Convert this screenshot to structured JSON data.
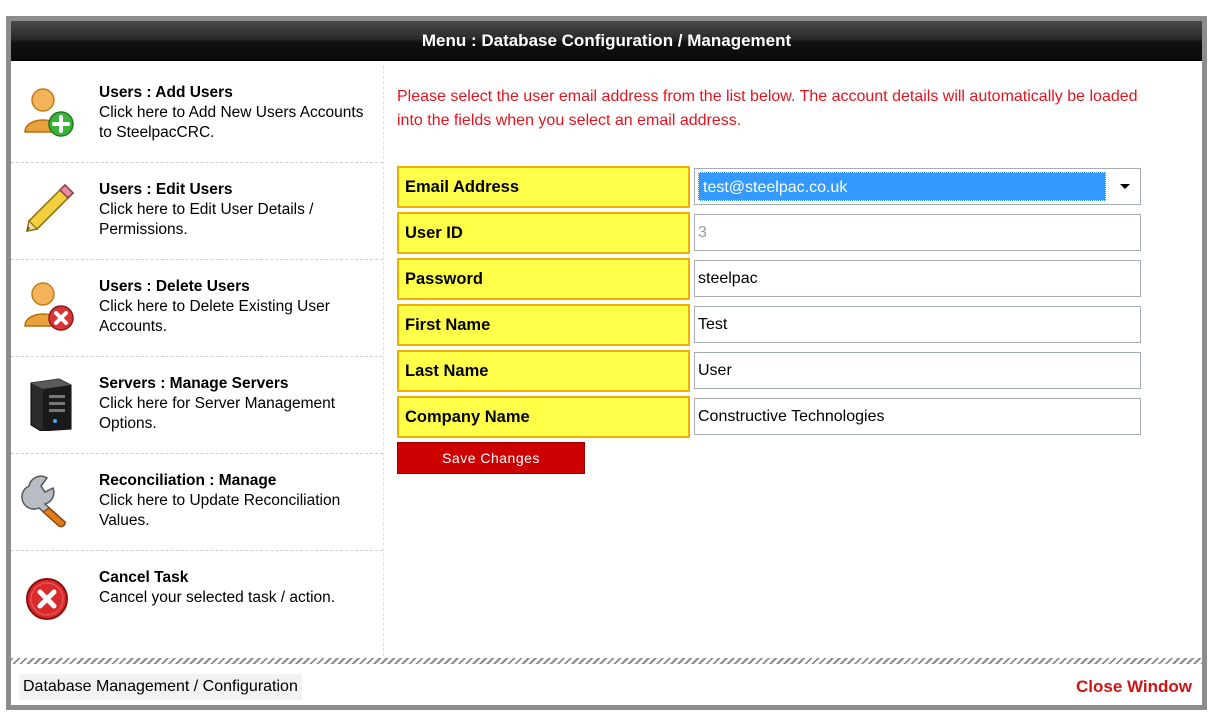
{
  "window": {
    "title": "Menu : Database Configuration / Management",
    "footer_label": "Database Management / Configuration",
    "close_label": "Close Window"
  },
  "sidebar": {
    "items": [
      {
        "icon": "add-user-icon",
        "title": "Users : Add Users",
        "desc": "Click here to Add New Users Accounts to SteelpacCRC."
      },
      {
        "icon": "pencil-icon",
        "title": "Users : Edit Users",
        "desc": "Click here to Edit User Details / Permissions."
      },
      {
        "icon": "delete-user-icon",
        "title": "Users : Delete Users",
        "desc": "Click here to Delete Existing User Accounts."
      },
      {
        "icon": "server-icon",
        "title": "Servers : Manage Servers",
        "desc": "Click here for Server Management Options."
      },
      {
        "icon": "wrench-icon",
        "title": "Reconciliation : Manage",
        "desc": "Click here to Update Reconciliation Values."
      },
      {
        "icon": "cancel-icon",
        "title": "Cancel Task",
        "desc": "Cancel your selected task / action."
      }
    ]
  },
  "instructions": "Please select the user email address from the list below. The account details will automatically be loaded into the fields when you select an email address.",
  "form": {
    "email": {
      "label": "Email Address",
      "value": "test@steelpac.co.uk"
    },
    "user_id": {
      "label": "User ID",
      "value": "3"
    },
    "password": {
      "label": "Password",
      "value": "steelpac"
    },
    "first_name": {
      "label": "First Name",
      "value": "Test"
    },
    "last_name": {
      "label": "Last Name",
      "value": "User"
    },
    "company": {
      "label": "Company Name",
      "value": "Constructive Technologies"
    },
    "save_label": "Save Changes"
  },
  "colors": {
    "accent_red": "#e4141e",
    "label_bg": "#ffff4a",
    "button_red": "#cc0000",
    "selection_blue": "#3399ff"
  }
}
